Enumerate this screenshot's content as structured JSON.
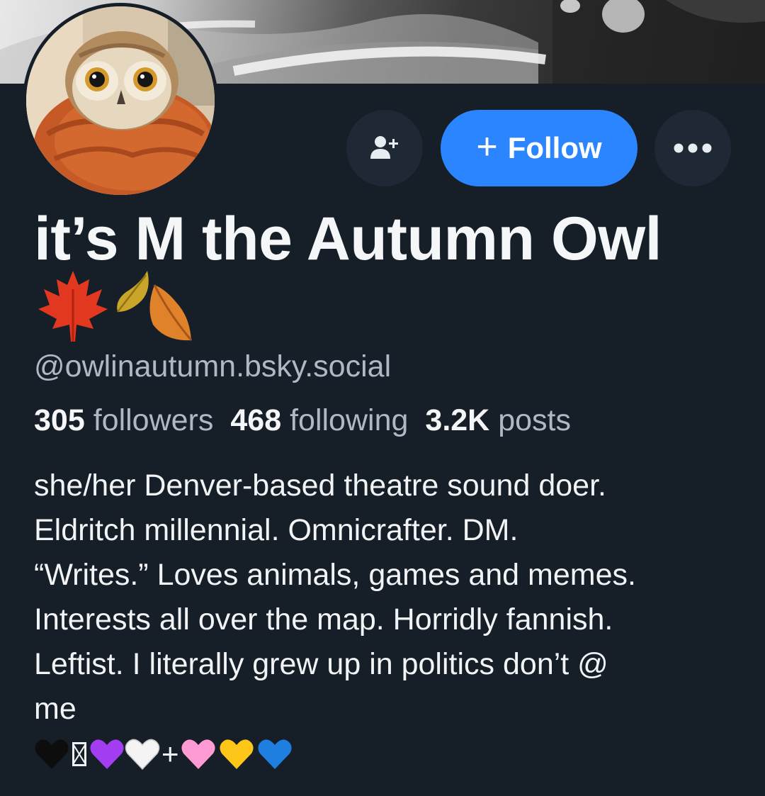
{
  "profile": {
    "display_name": "it’s M the Autumn Owl",
    "name_emoji": [
      "maple-leaf",
      "falling-leaf",
      "fallen-leaf"
    ],
    "handle": "@owlinautumn.bsky.social",
    "stats": {
      "followers_count": "305",
      "followers_label": "followers",
      "following_count": "468",
      "following_label": "following",
      "posts_count": "3.2K",
      "posts_label": "posts"
    },
    "bio_lines": [
      "she/her Denver-based theatre sound doer.",
      "Eldritch millennial. Omnicrafter. DM.",
      "“Writes.” Loves animals, games and memes.",
      "Interests all over the map. Horridly fannish.",
      "Leftist. I literally grew up in politics don’t @",
      "me"
    ],
    "bio_emoji": [
      {
        "name": "black-heart",
        "color": "#111111"
      },
      {
        "name": "unknown-glyph"
      },
      {
        "name": "purple-heart",
        "color": "#a33df2"
      },
      {
        "name": "white-heart",
        "color": "#f4f4f4"
      },
      {
        "name": "plus",
        "text": "+"
      },
      {
        "name": "pink-heart",
        "color": "#ff9ad5"
      },
      {
        "name": "yellow-heart",
        "color": "#ffc61a"
      },
      {
        "name": "blue-heart",
        "color": "#1f7fe0"
      }
    ]
  },
  "actions": {
    "follow_plus": "+",
    "follow_label": "Follow",
    "add_user_icon": "user-plus-icon",
    "more_icon": "ellipsis-icon"
  },
  "colors": {
    "background": "#161e27",
    "accent": "#2a85ff",
    "secondary_text": "#aeb9c6",
    "button_surface": "#1e2935"
  }
}
